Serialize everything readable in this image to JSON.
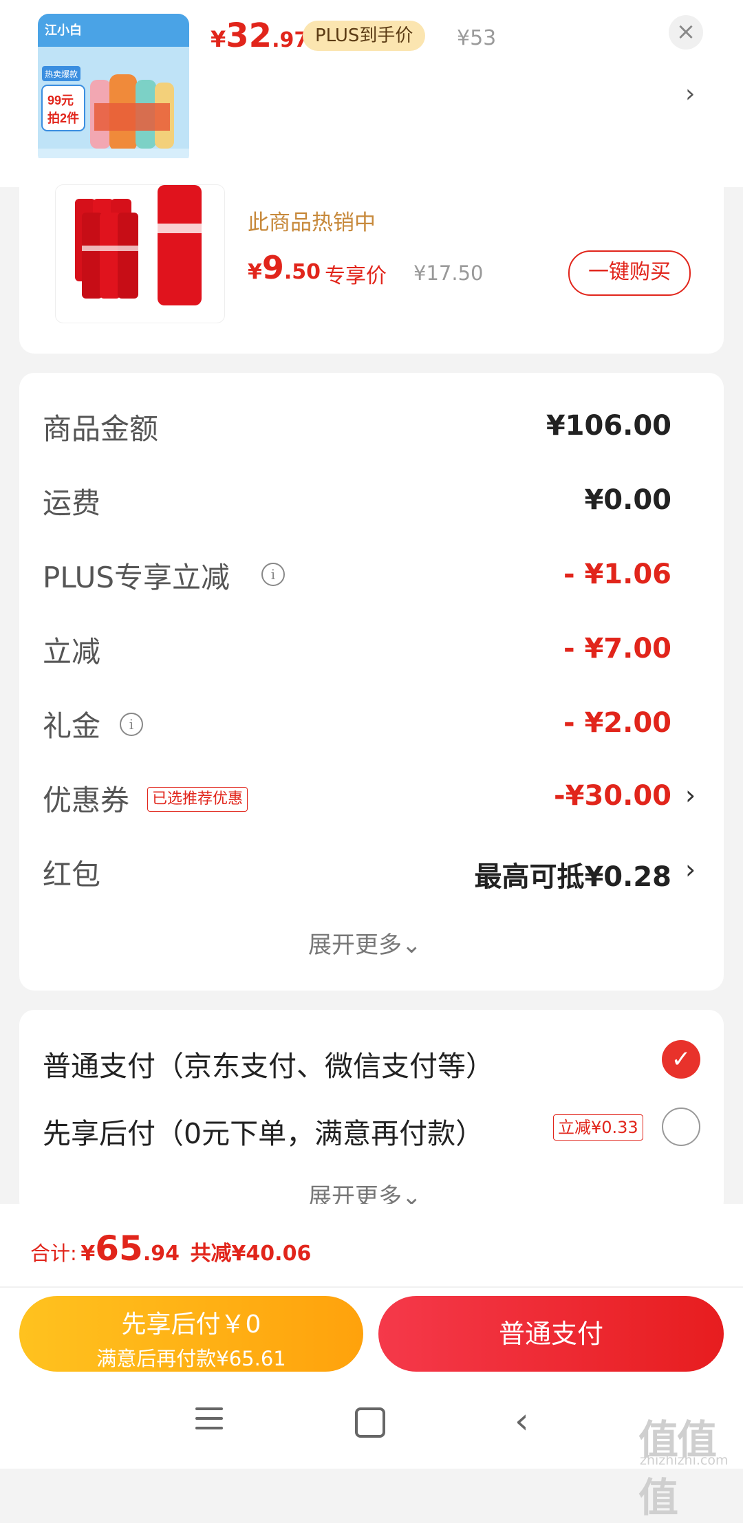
{
  "top_banner": {
    "thumb_brand": "江小白",
    "thumb_tag": "热卖爆款",
    "thumb_promo_line1": "99元",
    "thumb_promo_line2": "拍2件",
    "price_currency": "¥",
    "price_int": "32",
    "price_dec": ".97",
    "plus_tag": "PLUS到手价",
    "original_price": "¥53",
    "close_icon": "×",
    "next_icon": "›"
  },
  "recommend": {
    "hot_text": "此商品热销中",
    "price_currency": "¥",
    "price_int": "9",
    "price_dec": ".50",
    "exclusive_label": "专享价",
    "original_price": "¥17.50",
    "buy_button": "一键购买"
  },
  "breakdown": {
    "rows": [
      {
        "label": "商品金额",
        "value": "¥106.00"
      },
      {
        "label": "运费",
        "value": "¥0.00"
      },
      {
        "label": "PLUS专享立减",
        "value": "- ¥1.06"
      },
      {
        "label": "立减",
        "value": "- ¥7.00"
      },
      {
        "label": "礼金",
        "value": "- ¥2.00"
      },
      {
        "label": "优惠券",
        "value": "-¥30.00",
        "badge": "已选推荐优惠"
      },
      {
        "label": "红包",
        "value": "最高可抵¥0.28"
      }
    ],
    "info_icon": "i",
    "chevron": "›",
    "expand_more": "展开更多",
    "expand_icon": "⌄"
  },
  "payment": {
    "option_normal": "普通支付（京东支付、微信支付等）",
    "option_later": "先享后付（0元下单，满意再付款）",
    "later_badge": "立减¥0.33",
    "check_icon": "✓",
    "expand_more": "展开更多",
    "expand_icon": "⌄"
  },
  "summary": {
    "total_label": "合计:",
    "currency": "¥",
    "total_int": "65",
    "total_dec": ".94",
    "saved": "共减¥40.06",
    "later_btn_line1": "先享后付￥0",
    "later_btn_line2": "满意后再付款¥65.61",
    "pay_btn": "普通支付"
  },
  "watermark": {
    "logo": "值值值",
    "site": "zhizhizhi.com"
  },
  "colors": {
    "accent_red": "#e1251b",
    "plus_gold": "#fbe5b0",
    "later_yellow": "#ffb516"
  }
}
